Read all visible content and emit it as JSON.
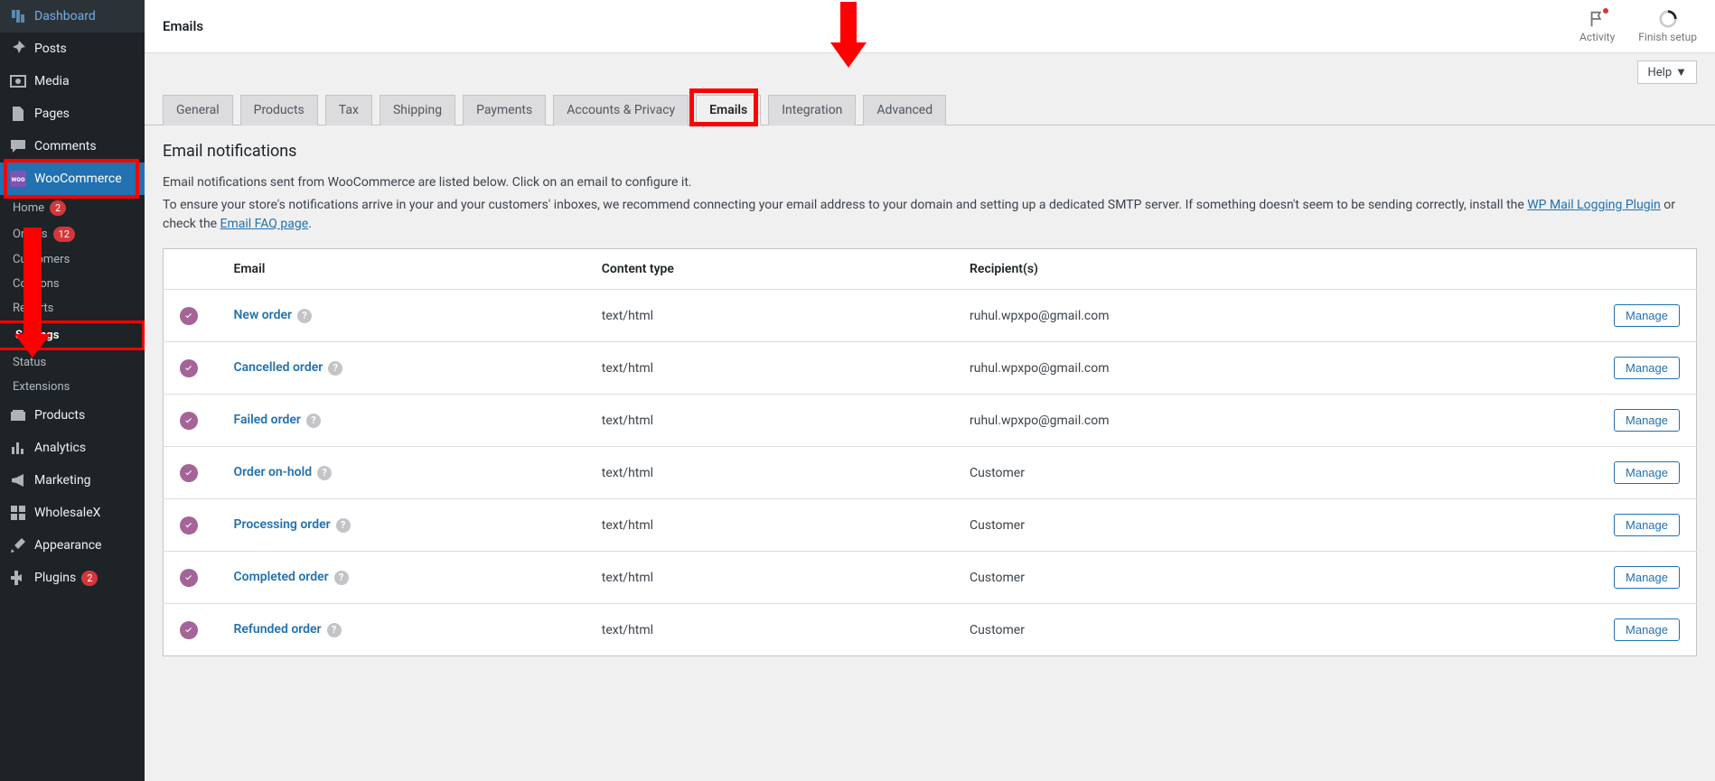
{
  "page_title": "Emails",
  "topbar": {
    "activity": "Activity",
    "finish_setup": "Finish setup",
    "help": "Help"
  },
  "sidebar": {
    "dashboard": "Dashboard",
    "posts": "Posts",
    "media": "Media",
    "pages": "Pages",
    "comments": "Comments",
    "woocommerce": "WooCommerce",
    "home": "Home",
    "home_count": "2",
    "orders": "Orders",
    "orders_count": "12",
    "customers": "Customers",
    "coupons": "Coupons",
    "reports": "Reports",
    "settings": "Settings",
    "status": "Status",
    "extensions": "Extensions",
    "products": "Products",
    "analytics": "Analytics",
    "marketing": "Marketing",
    "wholesalex": "WholesaleX",
    "appearance": "Appearance",
    "plugins": "Plugins",
    "plugins_count": "2"
  },
  "tabs": {
    "general": "General",
    "products": "Products",
    "tax": "Tax",
    "shipping": "Shipping",
    "payments": "Payments",
    "accounts": "Accounts & Privacy",
    "emails": "Emails",
    "integration": "Integration",
    "advanced": "Advanced"
  },
  "section": {
    "heading": "Email notifications",
    "desc1": "Email notifications sent from WooCommerce are listed below. Click on an email to configure it.",
    "desc2_pre": "To ensure your store's notifications arrive in your and your customers' inboxes, we recommend connecting your email address to your domain and setting up a dedicated SMTP server. If something doesn't seem to be sending correctly, install the ",
    "link1": "WP Mail Logging Plugin",
    "desc2_mid": " or check the ",
    "link2": "Email FAQ page",
    "desc2_end": "."
  },
  "table": {
    "th_email": "Email",
    "th_content": "Content type",
    "th_recipients": "Recipient(s)",
    "manage": "Manage",
    "rows": [
      {
        "name": "New order",
        "ct": "text/html",
        "rec": "ruhul.wpxpo@gmail.com"
      },
      {
        "name": "Cancelled order",
        "ct": "text/html",
        "rec": "ruhul.wpxpo@gmail.com"
      },
      {
        "name": "Failed order",
        "ct": "text/html",
        "rec": "ruhul.wpxpo@gmail.com"
      },
      {
        "name": "Order on-hold",
        "ct": "text/html",
        "rec": "Customer"
      },
      {
        "name": "Processing order",
        "ct": "text/html",
        "rec": "Customer"
      },
      {
        "name": "Completed order",
        "ct": "text/html",
        "rec": "Customer"
      },
      {
        "name": "Refunded order",
        "ct": "text/html",
        "rec": "Customer"
      }
    ]
  }
}
